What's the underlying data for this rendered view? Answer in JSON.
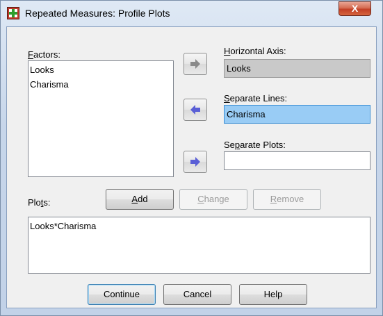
{
  "window": {
    "title": "Repeated Measures: Profile Plots",
    "close_symbol": "X"
  },
  "factors": {
    "label_accel": "F",
    "label_rest": "actors:",
    "items": [
      "Looks",
      "Charisma"
    ]
  },
  "horizontal_axis": {
    "label_accel": "H",
    "label_rest": "orizontal Axis:",
    "value": "Looks"
  },
  "separate_lines": {
    "label_accel": "S",
    "label_rest": "eparate Lines:",
    "value": "Charisma"
  },
  "separate_plots": {
    "label_pre": "Se",
    "label_accel": "p",
    "label_rest": "arate Plots:",
    "value": ""
  },
  "plots": {
    "label_pre": "Plo",
    "label_accel": "t",
    "label_rest": "s:",
    "items": [
      "Looks*Charisma"
    ]
  },
  "plot_buttons": {
    "add_accel": "A",
    "add_rest": "dd",
    "change_accel": "C",
    "change_rest": "hange",
    "remove_accel": "R",
    "remove_rest": "emove"
  },
  "footer": {
    "continue_label": "Continue",
    "cancel_label": "Cancel",
    "help_label": "Help"
  },
  "colors": {
    "arrow_active": "#5a5fd6",
    "arrow_disabled": "#8a8a8a",
    "selected_field": "#99ccf5"
  }
}
